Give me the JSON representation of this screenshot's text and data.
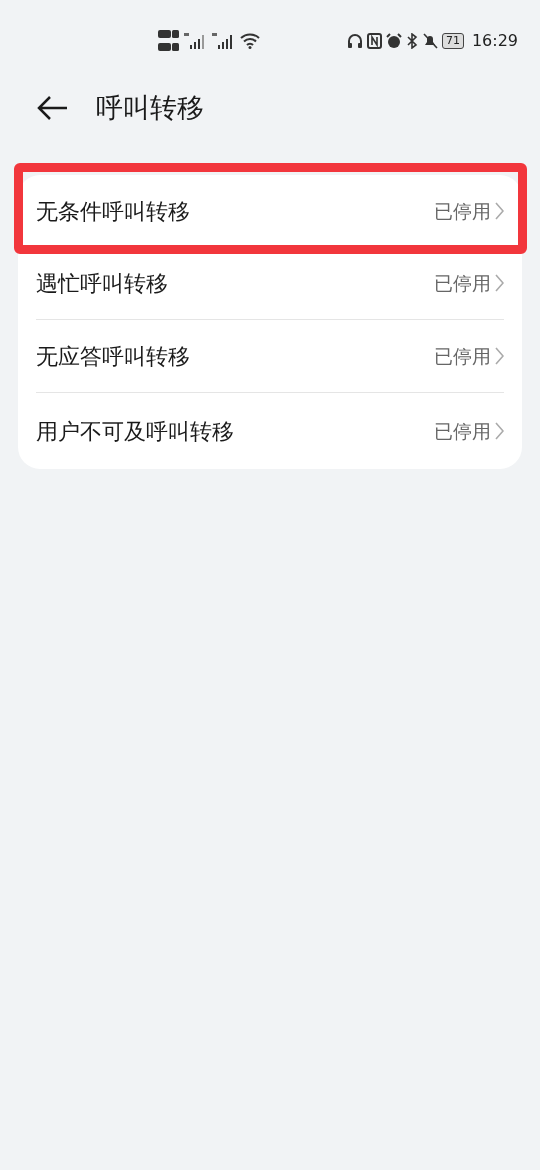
{
  "status_bar": {
    "battery": "71",
    "time": "16:29"
  },
  "header": {
    "title": "呼叫转移"
  },
  "items": [
    {
      "label": "无条件呼叫转移",
      "value": "已停用",
      "highlighted": true
    },
    {
      "label": "遇忙呼叫转移",
      "value": "已停用",
      "highlighted": false
    },
    {
      "label": "无应答呼叫转移",
      "value": "已停用",
      "highlighted": false
    },
    {
      "label": "用户不可及呼叫转移",
      "value": "已停用",
      "highlighted": false
    }
  ]
}
